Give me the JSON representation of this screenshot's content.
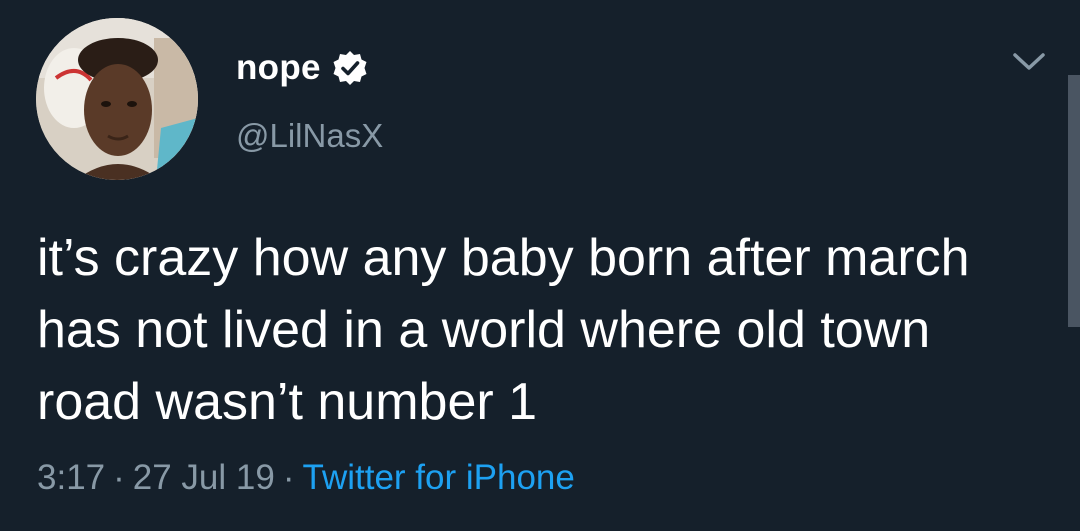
{
  "tweet": {
    "display_name": "nope",
    "handle": "@LilNasX",
    "verified": true,
    "text": "it’s crazy how any baby born after march has not lived in a world where old town road wasn’t number 1",
    "time": "3:17",
    "date": "27 Jul 19",
    "separator": "·",
    "source": "Twitter for iPhone"
  },
  "icons": {
    "verified": "verified-badge-icon",
    "menu": "chevron-down-icon"
  },
  "colors": {
    "background": "#15202b",
    "primary_text": "#ffffff",
    "secondary_text": "#8899a6",
    "link": "#1da1f2"
  }
}
